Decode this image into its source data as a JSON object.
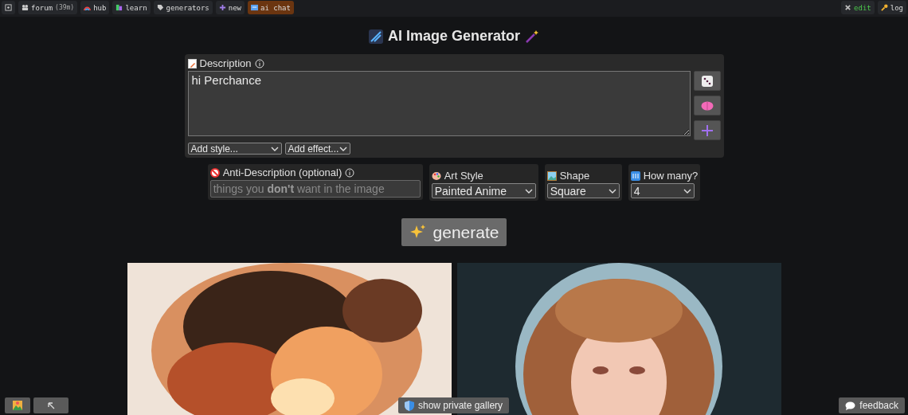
{
  "top_bar": {
    "left": [
      {
        "kind": "home",
        "selected": false
      },
      {
        "kind": "forum",
        "label": "forum",
        "note": "(39m)",
        "selected": false
      },
      {
        "kind": "hub",
        "label": "hub",
        "selected": false
      },
      {
        "kind": "learn",
        "label": "learn",
        "selected": false
      },
      {
        "kind": "generators",
        "label": "generators",
        "selected": false
      },
      {
        "kind": "new",
        "label": "new",
        "selected": false
      },
      {
        "kind": "chat",
        "label": "ai chat",
        "selected": true
      }
    ],
    "right": [
      {
        "kind": "edit",
        "label": "edit"
      },
      {
        "kind": "login",
        "label": "log"
      }
    ]
  },
  "title": "AI Image Generator",
  "description": {
    "label": "Description",
    "value": "hi Perchance",
    "selects": [
      "Add style...",
      "Add effect..."
    ]
  },
  "anti_description": {
    "label": "Anti-Description (optional)",
    "placeholder": "things you **don't** want in the image"
  },
  "options": [
    {
      "kind": "palette",
      "label": "Art Style",
      "value": "Painted Anime"
    },
    {
      "kind": "shape",
      "label": "Shape",
      "value": "Square"
    },
    {
      "kind": "count",
      "label": "How many?",
      "value": "4"
    }
  ],
  "generate_button": "generate",
  "bottom": {
    "gallery_button": "show private gallery",
    "feedback_button": "feedback"
  }
}
